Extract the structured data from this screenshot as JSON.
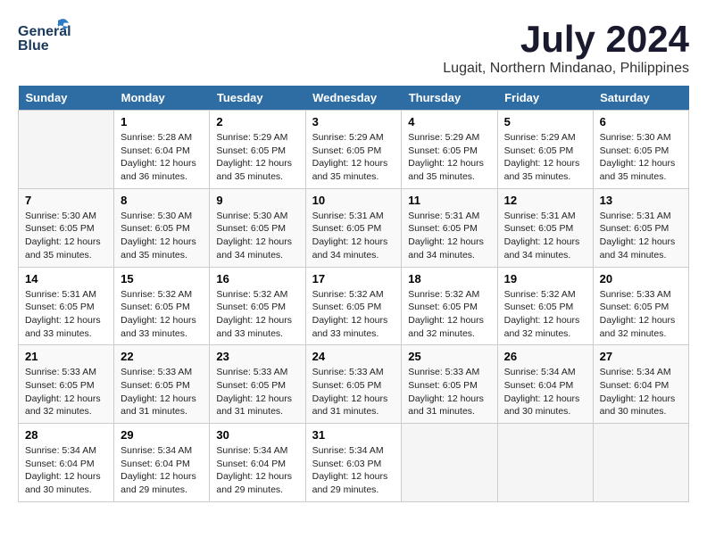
{
  "header": {
    "logo_line1": "General",
    "logo_line2": "Blue",
    "month_year": "July 2024",
    "location": "Lugait, Northern Mindanao, Philippines"
  },
  "days_of_week": [
    "Sunday",
    "Monday",
    "Tuesday",
    "Wednesday",
    "Thursday",
    "Friday",
    "Saturday"
  ],
  "weeks": [
    [
      {
        "day": "",
        "info": ""
      },
      {
        "day": "1",
        "info": "Sunrise: 5:28 AM\nSunset: 6:04 PM\nDaylight: 12 hours\nand 36 minutes."
      },
      {
        "day": "2",
        "info": "Sunrise: 5:29 AM\nSunset: 6:05 PM\nDaylight: 12 hours\nand 35 minutes."
      },
      {
        "day": "3",
        "info": "Sunrise: 5:29 AM\nSunset: 6:05 PM\nDaylight: 12 hours\nand 35 minutes."
      },
      {
        "day": "4",
        "info": "Sunrise: 5:29 AM\nSunset: 6:05 PM\nDaylight: 12 hours\nand 35 minutes."
      },
      {
        "day": "5",
        "info": "Sunrise: 5:29 AM\nSunset: 6:05 PM\nDaylight: 12 hours\nand 35 minutes."
      },
      {
        "day": "6",
        "info": "Sunrise: 5:30 AM\nSunset: 6:05 PM\nDaylight: 12 hours\nand 35 minutes."
      }
    ],
    [
      {
        "day": "7",
        "info": "Sunrise: 5:30 AM\nSunset: 6:05 PM\nDaylight: 12 hours\nand 35 minutes."
      },
      {
        "day": "8",
        "info": "Sunrise: 5:30 AM\nSunset: 6:05 PM\nDaylight: 12 hours\nand 35 minutes."
      },
      {
        "day": "9",
        "info": "Sunrise: 5:30 AM\nSunset: 6:05 PM\nDaylight: 12 hours\nand 34 minutes."
      },
      {
        "day": "10",
        "info": "Sunrise: 5:31 AM\nSunset: 6:05 PM\nDaylight: 12 hours\nand 34 minutes."
      },
      {
        "day": "11",
        "info": "Sunrise: 5:31 AM\nSunset: 6:05 PM\nDaylight: 12 hours\nand 34 minutes."
      },
      {
        "day": "12",
        "info": "Sunrise: 5:31 AM\nSunset: 6:05 PM\nDaylight: 12 hours\nand 34 minutes."
      },
      {
        "day": "13",
        "info": "Sunrise: 5:31 AM\nSunset: 6:05 PM\nDaylight: 12 hours\nand 34 minutes."
      }
    ],
    [
      {
        "day": "14",
        "info": "Sunrise: 5:31 AM\nSunset: 6:05 PM\nDaylight: 12 hours\nand 33 minutes."
      },
      {
        "day": "15",
        "info": "Sunrise: 5:32 AM\nSunset: 6:05 PM\nDaylight: 12 hours\nand 33 minutes."
      },
      {
        "day": "16",
        "info": "Sunrise: 5:32 AM\nSunset: 6:05 PM\nDaylight: 12 hours\nand 33 minutes."
      },
      {
        "day": "17",
        "info": "Sunrise: 5:32 AM\nSunset: 6:05 PM\nDaylight: 12 hours\nand 33 minutes."
      },
      {
        "day": "18",
        "info": "Sunrise: 5:32 AM\nSunset: 6:05 PM\nDaylight: 12 hours\nand 32 minutes."
      },
      {
        "day": "19",
        "info": "Sunrise: 5:32 AM\nSunset: 6:05 PM\nDaylight: 12 hours\nand 32 minutes."
      },
      {
        "day": "20",
        "info": "Sunrise: 5:33 AM\nSunset: 6:05 PM\nDaylight: 12 hours\nand 32 minutes."
      }
    ],
    [
      {
        "day": "21",
        "info": "Sunrise: 5:33 AM\nSunset: 6:05 PM\nDaylight: 12 hours\nand 32 minutes."
      },
      {
        "day": "22",
        "info": "Sunrise: 5:33 AM\nSunset: 6:05 PM\nDaylight: 12 hours\nand 31 minutes."
      },
      {
        "day": "23",
        "info": "Sunrise: 5:33 AM\nSunset: 6:05 PM\nDaylight: 12 hours\nand 31 minutes."
      },
      {
        "day": "24",
        "info": "Sunrise: 5:33 AM\nSunset: 6:05 PM\nDaylight: 12 hours\nand 31 minutes."
      },
      {
        "day": "25",
        "info": "Sunrise: 5:33 AM\nSunset: 6:05 PM\nDaylight: 12 hours\nand 31 minutes."
      },
      {
        "day": "26",
        "info": "Sunrise: 5:34 AM\nSunset: 6:04 PM\nDaylight: 12 hours\nand 30 minutes."
      },
      {
        "day": "27",
        "info": "Sunrise: 5:34 AM\nSunset: 6:04 PM\nDaylight: 12 hours\nand 30 minutes."
      }
    ],
    [
      {
        "day": "28",
        "info": "Sunrise: 5:34 AM\nSunset: 6:04 PM\nDaylight: 12 hours\nand 30 minutes."
      },
      {
        "day": "29",
        "info": "Sunrise: 5:34 AM\nSunset: 6:04 PM\nDaylight: 12 hours\nand 29 minutes."
      },
      {
        "day": "30",
        "info": "Sunrise: 5:34 AM\nSunset: 6:04 PM\nDaylight: 12 hours\nand 29 minutes."
      },
      {
        "day": "31",
        "info": "Sunrise: 5:34 AM\nSunset: 6:03 PM\nDaylight: 12 hours\nand 29 minutes."
      },
      {
        "day": "",
        "info": ""
      },
      {
        "day": "",
        "info": ""
      },
      {
        "day": "",
        "info": ""
      }
    ]
  ]
}
